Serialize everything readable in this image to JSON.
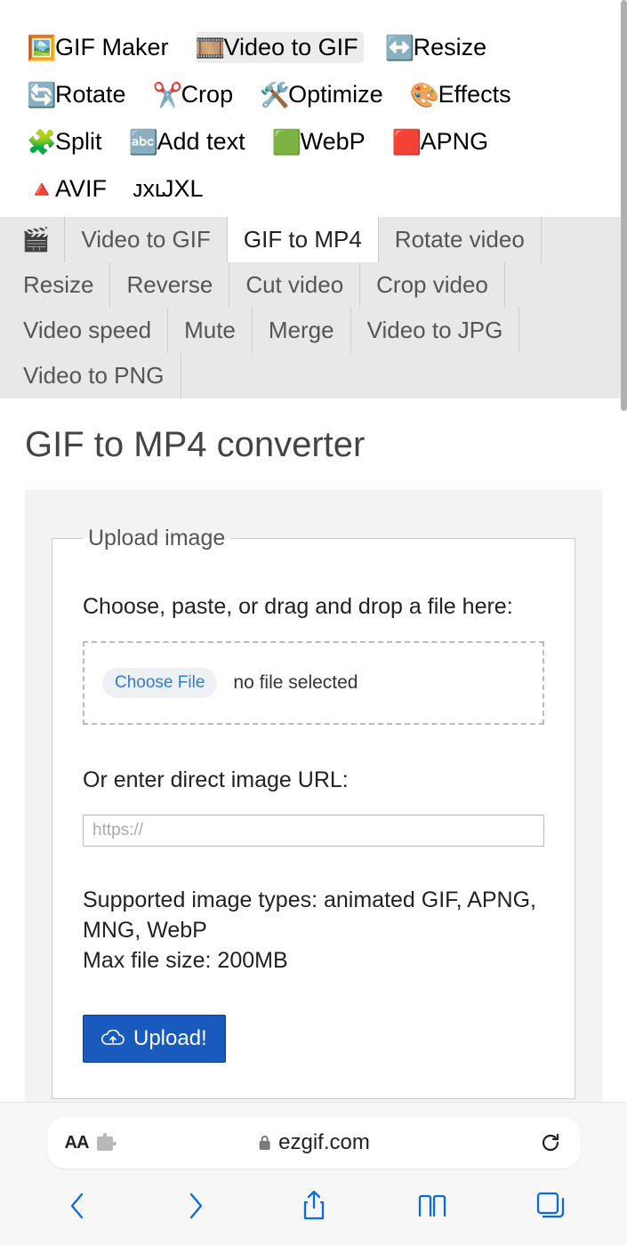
{
  "tools": [
    {
      "id": "gif-maker",
      "label": "GIF Maker",
      "icon": "🖼️",
      "active": false
    },
    {
      "id": "video-to-gif",
      "label": "Video to GIF",
      "icon": "🎞️",
      "active": true
    },
    {
      "id": "resize",
      "label": "Resize",
      "icon": "↔️",
      "active": false
    },
    {
      "id": "rotate",
      "label": "Rotate",
      "icon": "🔄",
      "active": false
    },
    {
      "id": "crop",
      "label": "Crop",
      "icon": "✂️",
      "active": false
    },
    {
      "id": "optimize",
      "label": "Optimize",
      "icon": "🛠️",
      "active": false
    },
    {
      "id": "effects",
      "label": "Effects",
      "icon": "🎨",
      "active": false
    },
    {
      "id": "split",
      "label": "Split",
      "icon": "🧩",
      "active": false
    },
    {
      "id": "add-text",
      "label": "Add text",
      "icon": "🔤",
      "active": false
    },
    {
      "id": "webp",
      "label": "WebP",
      "icon": "🟩",
      "active": false
    },
    {
      "id": "apng",
      "label": "APNG",
      "icon": "🟥",
      "active": false
    },
    {
      "id": "avif",
      "label": "AVIF",
      "icon": "🔺",
      "active": false
    },
    {
      "id": "jxl",
      "label": "JXL",
      "icon": "ᴊxʟ",
      "active": false
    }
  ],
  "subnav": {
    "home_icon": "🎬",
    "items": [
      {
        "id": "video-to-gif",
        "label": "Video to GIF",
        "active": false
      },
      {
        "id": "gif-to-mp4",
        "label": "GIF to MP4",
        "active": true
      },
      {
        "id": "rotate-video",
        "label": "Rotate video",
        "active": false
      },
      {
        "id": "resize",
        "label": "Resize",
        "active": false
      },
      {
        "id": "reverse",
        "label": "Reverse",
        "active": false
      },
      {
        "id": "cut-video",
        "label": "Cut video",
        "active": false
      },
      {
        "id": "crop-video",
        "label": "Crop video",
        "active": false
      },
      {
        "id": "video-speed",
        "label": "Video speed",
        "active": false
      },
      {
        "id": "mute",
        "label": "Mute",
        "active": false
      },
      {
        "id": "merge",
        "label": "Merge",
        "active": false
      },
      {
        "id": "video-to-jpg",
        "label": "Video to JPG",
        "active": false
      },
      {
        "id": "video-to-png",
        "label": "Video to PNG",
        "active": false
      }
    ]
  },
  "page": {
    "title": "GIF to MP4 converter",
    "fieldset_legend": "Upload image",
    "choose_instruction": "Choose, paste, or drag and drop a file here:",
    "choose_file_label": "Choose File",
    "no_file_text": "no file selected",
    "url_label": "Or enter direct image URL:",
    "url_placeholder": "https://",
    "supported_line1": "Supported image types: animated GIF, APNG, MNG, WebP",
    "supported_line2": "Max file size: 200MB",
    "upload_button": "Upload!"
  },
  "browser": {
    "aa_label": "AA",
    "domain": "ezgif.com"
  }
}
